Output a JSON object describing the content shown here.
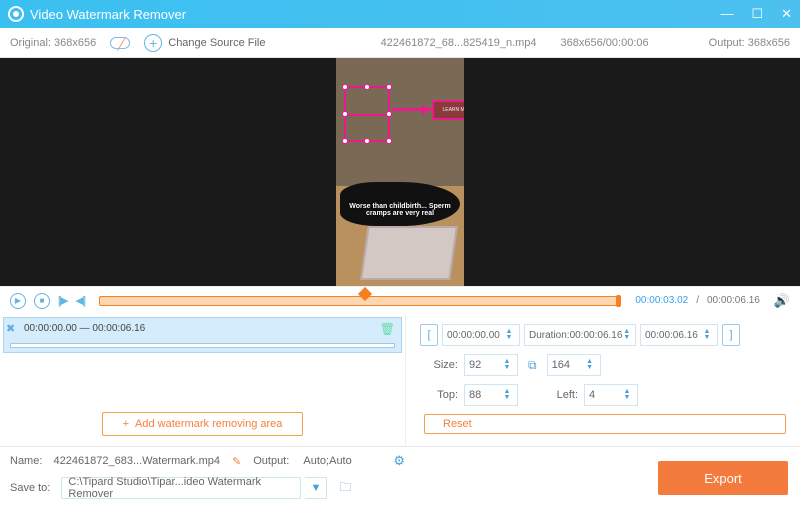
{
  "titlebar": {
    "app_name": "Video Watermark Remover"
  },
  "subbar": {
    "original_label": "Original:",
    "original_dim": "368x656",
    "change_source": "Change Source File",
    "filename": "422461872_68...825419_n.mp4",
    "file_dim_time": "368x656/00:00:06",
    "output_label": "Output:",
    "output_dim": "368x656"
  },
  "preview": {
    "caption": "Worse than childbirth... Sperm cramps are very real",
    "badge_text": "LEARN MORE"
  },
  "controls": {
    "bracket_in": "[▶",
    "bracket_out": "◀]",
    "time_current": "00:00:03.02",
    "time_sep": "/",
    "time_total": "00:00:06.16"
  },
  "segment": {
    "start": "00:00:00.00",
    "dash": "—",
    "end": "00:00:06.16"
  },
  "add_area": "Add watermark removing area",
  "range": {
    "start": "00:00:00.00",
    "duration_label": "Duration:",
    "duration": "00:00:06.16",
    "end": "00:00:06.16"
  },
  "size": {
    "label": "Size:",
    "w": "92",
    "h": "164"
  },
  "pos": {
    "top_label": "Top:",
    "top": "88",
    "left_label": "Left:",
    "left": "4"
  },
  "reset": "Reset",
  "footer": {
    "name_label": "Name:",
    "name_value": "422461872_683...Watermark.mp4",
    "output_label": "Output:",
    "output_value": "Auto;Auto",
    "save_label": "Save to:",
    "save_path": "C:\\Tipard Studio\\Tipar...ideo Watermark Remover",
    "export": "Export"
  }
}
